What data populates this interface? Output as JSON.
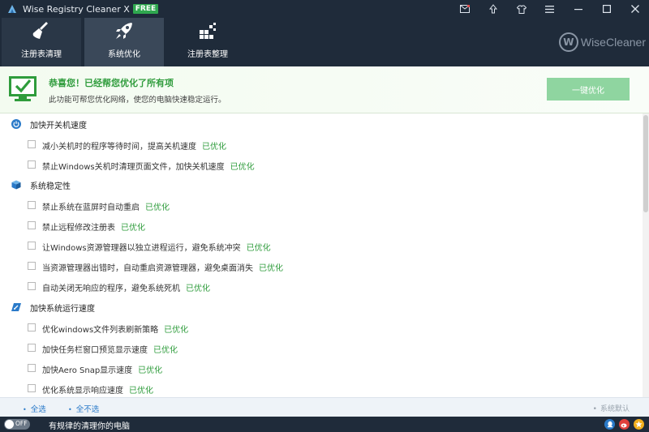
{
  "window": {
    "title": "Wise Registry Cleaner X",
    "badge": "FREE",
    "icons": [
      "mail-icon",
      "upload-icon",
      "skin-icon",
      "menu-icon",
      "minimize-icon",
      "maximize-icon",
      "close-icon"
    ]
  },
  "toolbar": {
    "tabs": [
      {
        "label": "注册表清理",
        "icon": "broom-icon"
      },
      {
        "label": "系统优化",
        "icon": "rocket-icon",
        "active": true
      },
      {
        "label": "注册表整理",
        "icon": "blocks-icon"
      }
    ],
    "brand": "WiseCleaner",
    "brand_mark": "W"
  },
  "banner": {
    "title": "恭喜您！已经帮您优化了所有项",
    "subtitle": "此功能可帮您优化网络，使您的电脑快速稳定运行。",
    "button": "一键优化",
    "accent": "#2f9c3c"
  },
  "sections": [
    {
      "title": "加快开关机速度",
      "icon": "power-icon",
      "items": [
        {
          "text": "减小关机时的程序等待时间，提高关机速度",
          "status": "已优化"
        },
        {
          "text": "禁止Windows关机时清理页面文件，加快关机速度",
          "status": "已优化"
        }
      ]
    },
    {
      "title": "系统稳定性",
      "icon": "cube-icon",
      "items": [
        {
          "text": "禁止系统在蓝屏时自动重启",
          "status": "已优化"
        },
        {
          "text": "禁止远程修改注册表",
          "status": "已优化"
        },
        {
          "text": "让Windows资源管理器以独立进程运行，避免系统冲突",
          "status": "已优化"
        },
        {
          "text": "当资源管理器出错时，自动重启资源管理器，避免桌面消失",
          "status": "已优化"
        },
        {
          "text": "自动关闭无响应的程序，避免系统死机",
          "status": "已优化"
        }
      ]
    },
    {
      "title": "加快系统运行速度",
      "icon": "speed-icon",
      "items": [
        {
          "text": "优化windows文件列表刷新策略",
          "status": "已优化"
        },
        {
          "text": "加快任务栏窗口预览显示速度",
          "status": "已优化"
        },
        {
          "text": "加快Aero Snap显示速度",
          "status": "已优化"
        },
        {
          "text": "优化系统显示响应速度",
          "status": "已优化"
        }
      ]
    }
  ],
  "actions": {
    "select_all": "全选",
    "select_none": "全不选",
    "default": "系统默认"
  },
  "statusbar": {
    "toggle": "OFF",
    "text": "有规律的清理你的电脑",
    "social": [
      "qq-icon",
      "weibo-icon",
      "star-icon"
    ]
  }
}
